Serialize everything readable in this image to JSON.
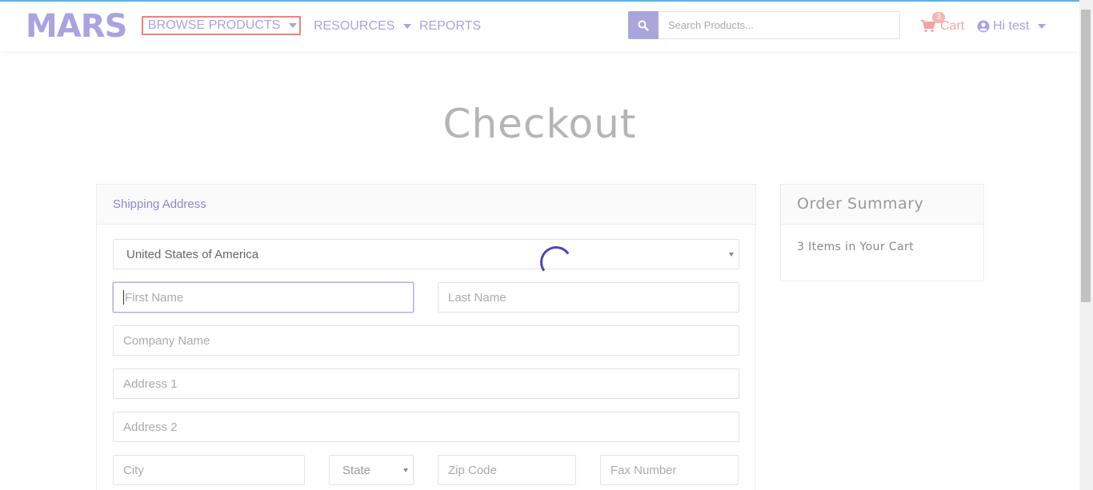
{
  "header": {
    "logo": "MARS",
    "nav": {
      "browse_products": "BROWSE PRODUCTS",
      "resources": "RESOURCES",
      "reports": "REPORTS"
    },
    "search": {
      "placeholder": "Search Products..."
    },
    "cart": {
      "count": "3",
      "label": "Cart"
    },
    "user": {
      "label": "Hi test"
    }
  },
  "page": {
    "title": "Checkout"
  },
  "shipping": {
    "heading": "Shipping Address",
    "country": "United States of America",
    "first_name_placeholder": "First Name",
    "last_name_placeholder": "Last Name",
    "company_placeholder": "Company Name",
    "address1_placeholder": "Address 1",
    "address2_placeholder": "Address 2",
    "city_placeholder": "City",
    "state": "State",
    "zip_placeholder": "Zip Code",
    "fax_placeholder": "Fax Number"
  },
  "order_summary": {
    "heading": "Order Summary",
    "items_text": "3 Items in Your Cart"
  },
  "colors": {
    "brand": "#a9a3e0",
    "cart": "#f4a3a3",
    "spinner": "#4b45b8",
    "focus_outline": "#f08080"
  },
  "icons": [
    "search-icon",
    "cart-icon",
    "user-circle-icon",
    "chevron-down-icon",
    "loading-spinner"
  ]
}
